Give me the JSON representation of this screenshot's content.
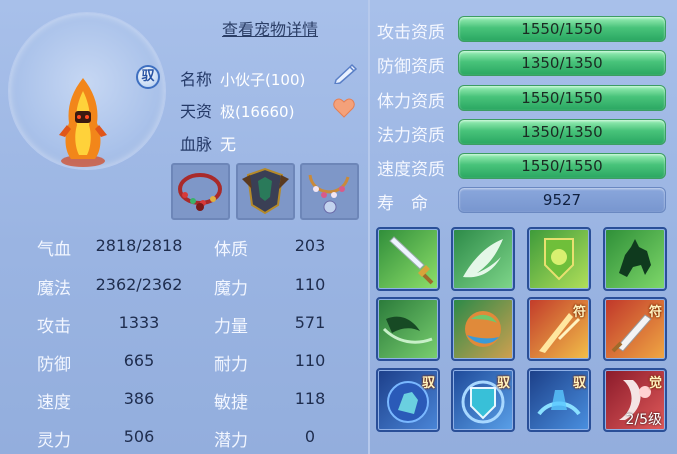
{
  "header": {
    "detail_link": "查看宠物详情"
  },
  "portrait": {
    "tame_badge": "驭"
  },
  "info": {
    "name_label": "名称",
    "name_value": "小伙子(100)",
    "talent_label": "天资",
    "talent_value": "极(16660)",
    "blood_label": "血脉",
    "blood_value": "无"
  },
  "stats": [
    {
      "label": "气血",
      "value": "2818/2818",
      "label2": "体质",
      "value2": "203"
    },
    {
      "label": "魔法",
      "value": "2362/2362",
      "label2": "魔力",
      "value2": "110"
    },
    {
      "label": "攻击",
      "value": "1333",
      "label2": "力量",
      "value2": "571"
    },
    {
      "label": "防御",
      "value": "665",
      "label2": "耐力",
      "value2": "110"
    },
    {
      "label": "速度",
      "value": "386",
      "label2": "敏捷",
      "value2": "118"
    },
    {
      "label": "灵力",
      "value": "506",
      "label2": "潜力",
      "value2": "0"
    }
  ],
  "aptitudes": [
    {
      "label": "攻击资质",
      "value": "1550/1550",
      "fill": 1.0
    },
    {
      "label": "防御资质",
      "value": "1350/1350",
      "fill": 1.0
    },
    {
      "label": "体力资质",
      "value": "1550/1550",
      "fill": 1.0
    },
    {
      "label": "法力资质",
      "value": "1350/1350",
      "fill": 1.0
    },
    {
      "label": "速度资质",
      "value": "1550/1550",
      "fill": 1.0
    }
  ],
  "life": {
    "label": "寿　命",
    "value": "9527"
  },
  "skills": {
    "row3_corner": "驭",
    "fu": "符",
    "jue": "觉",
    "awaken_level": "2/5级"
  }
}
